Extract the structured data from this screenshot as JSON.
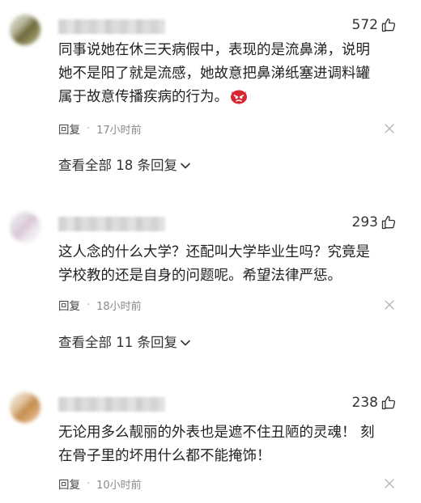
{
  "comments": [
    {
      "likes": "572",
      "text": "同事说她在休三天病假中，表现的是流鼻涕，说明她不是阳了就是流感，她故意把鼻涕纸塞进调料罐属于故意传播疾病的行为。",
      "emoji": "angry-face",
      "reply_label": "回复",
      "separator": "·",
      "time": "17小时前",
      "view_all": "查看全部 18 条回复"
    },
    {
      "likes": "293",
      "text": "这人念的什么大学？还配叫大学毕业生吗？究竟是学校教的还是自身的问题呢。希望法律严惩。",
      "reply_label": "回复",
      "separator": "·",
      "time": "18小时前",
      "view_all": "查看全部 11 条回复"
    },
    {
      "likes": "238",
      "text": "无论用多么靓丽的外表也是遮不住丑陋的灵魂！ 刻在骨子里的坏用什么都不能掩饰！",
      "reply_label": "回复",
      "separator": "·",
      "time": "10小时前"
    }
  ],
  "colors": {
    "text": "#222222",
    "meta": "#8a8a8a",
    "emoji_red": "#d9252f"
  },
  "icons": {
    "like": "thumbs-up-icon",
    "close": "close-icon",
    "expand": "chevron-down-icon"
  }
}
